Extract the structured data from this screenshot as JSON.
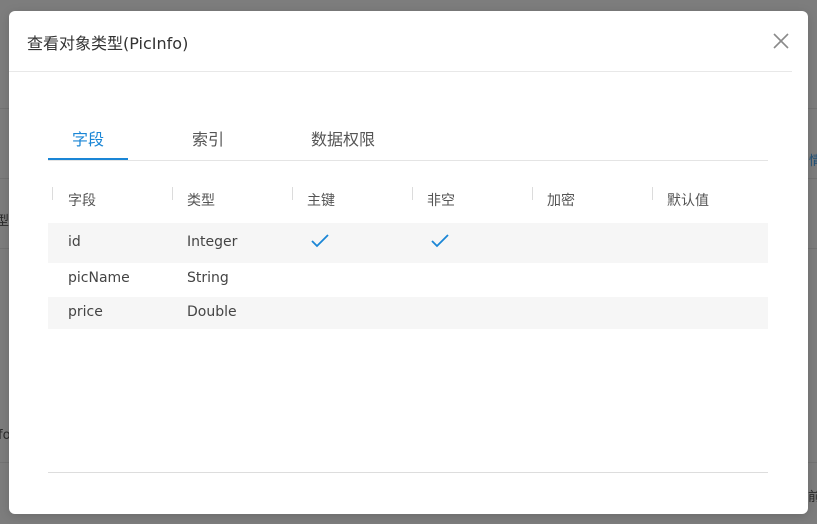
{
  "background": {
    "fragments": [
      "型",
      "fo",
      "情",
      "前"
    ]
  },
  "modal": {
    "title": "查看对象类型(PicInfo)",
    "close_icon": "close-icon",
    "tabs": [
      {
        "label": "字段",
        "active": true
      },
      {
        "label": "索引",
        "active": false
      },
      {
        "label": "数据权限",
        "active": false
      }
    ],
    "table": {
      "columns": [
        "字段",
        "类型",
        "主键",
        "非空",
        "加密",
        "默认值"
      ],
      "rows": [
        {
          "field": "id",
          "type": "Integer",
          "primary_key": true,
          "not_null": true,
          "encrypted": false,
          "default": ""
        },
        {
          "field": "picName",
          "type": "String",
          "primary_key": false,
          "not_null": false,
          "encrypted": false,
          "default": ""
        },
        {
          "field": "price",
          "type": "Double",
          "primary_key": false,
          "not_null": false,
          "encrypted": false,
          "default": ""
        }
      ],
      "check_icon": "check-icon"
    }
  },
  "colors": {
    "accent": "#1a86d6",
    "overlay": "#7f7f7f",
    "stripe": "#f6f6f6"
  }
}
